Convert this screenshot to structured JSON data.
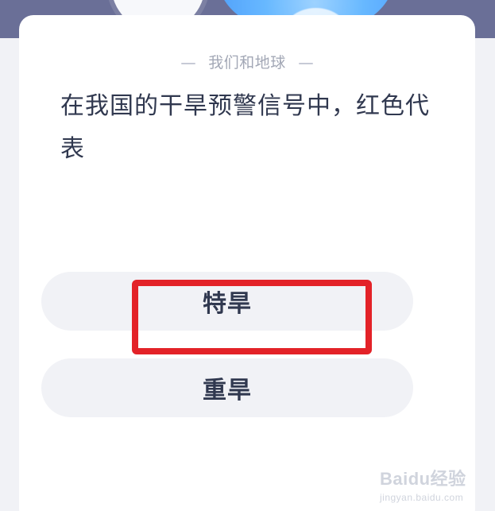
{
  "quiz": {
    "category": "我们和地球",
    "question": "在我国的干旱预警信号中，红色代表",
    "options": [
      {
        "label": "特旱",
        "highlighted": true
      },
      {
        "label": "重旱",
        "highlighted": false
      }
    ]
  },
  "colors": {
    "top_band": "#6a6f97",
    "card_bg": "#ffffff",
    "page_bg": "#f1f2f6",
    "option_bg": "#f1f2f6",
    "text_primary": "#30384f",
    "text_muted": "#a3a8b6",
    "highlight": "#e32228"
  },
  "watermark": {
    "text": "Baidu经验",
    "url": "jingyan.baidu.com"
  }
}
